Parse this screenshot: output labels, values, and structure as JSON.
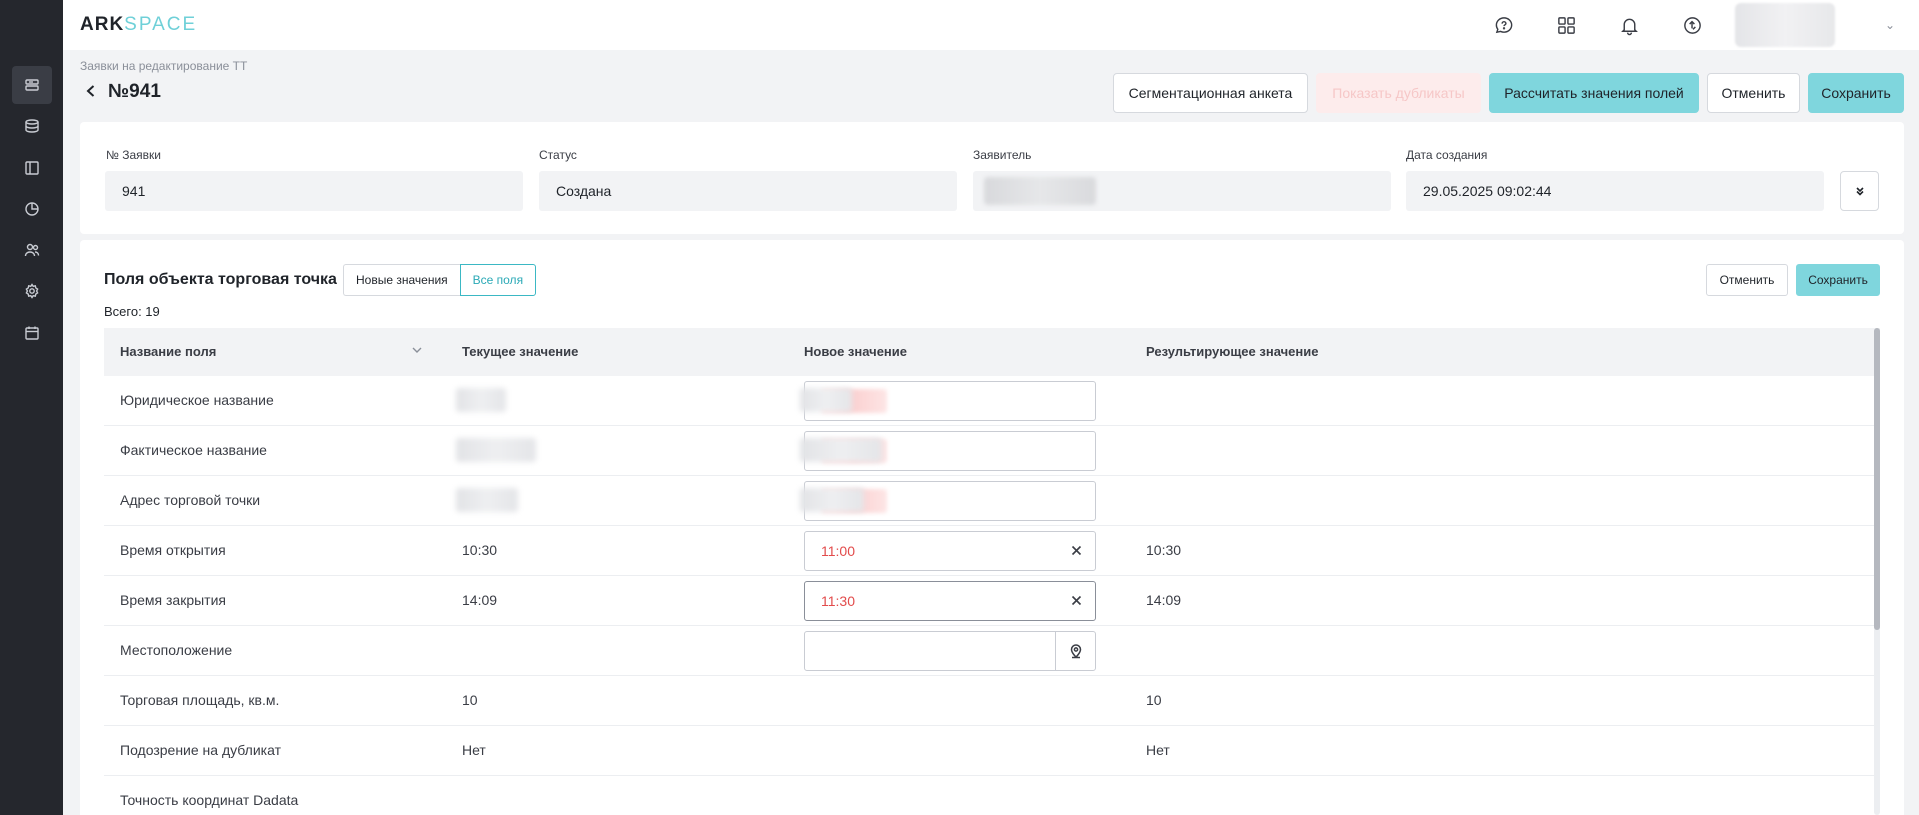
{
  "app": {
    "logo_main": "ARK",
    "logo_accent": "SPACE"
  },
  "sidebar": {
    "items": [
      {
        "icon": "requests-icon",
        "active": true
      },
      {
        "icon": "database-icon",
        "active": false
      },
      {
        "icon": "layout-icon",
        "active": false
      },
      {
        "icon": "chart-icon",
        "active": false
      },
      {
        "icon": "users-icon",
        "active": false
      },
      {
        "icon": "settings-icon",
        "active": false
      },
      {
        "icon": "calendar-icon",
        "active": false
      }
    ]
  },
  "topbar": {
    "icons": [
      "help-chat-icon",
      "apps-grid-icon",
      "bell-icon",
      "sync-icon"
    ]
  },
  "header": {
    "breadcrumb": "Заявки на редактирование ТТ",
    "title": "№941",
    "buttons": {
      "segmentation": "Сегментационная анкета",
      "duplicates": "Показать дубликаты",
      "calculate": "Рассчитать значения полей",
      "cancel": "Отменить",
      "save": "Сохранить"
    }
  },
  "info": {
    "request_no_label": "№ Заявки",
    "request_no_value": "941",
    "status_label": "Статус",
    "status_value": "Создана",
    "applicant_label": "Заявитель",
    "created_label": "Дата создания",
    "created_value": "29.05.2025 09:02:44"
  },
  "fields_section": {
    "title": "Поля объекта торговая точка",
    "toggle_new": "Новые значения",
    "toggle_all": "Все поля",
    "total": "Всего: 19",
    "cancel": "Отменить",
    "save": "Сохранить",
    "columns": {
      "name": "Название поля",
      "current": "Текущее значение",
      "new": "Новое значение",
      "result": "Результирующее значение"
    },
    "rows": [
      {
        "name": "Юридическое название",
        "current": "",
        "new": "",
        "result": ""
      },
      {
        "name": "Фактическое название",
        "current": "",
        "new": "",
        "result": ""
      },
      {
        "name": "Адрес торговой точки",
        "current": "",
        "new": "",
        "result": ""
      },
      {
        "name": "Время открытия",
        "current": "10:30",
        "new": "11:00",
        "result": "10:30"
      },
      {
        "name": "Время закрытия",
        "current": "14:09",
        "new": "11:30",
        "result": "14:09"
      },
      {
        "name": "Местоположение",
        "current": "",
        "new": "",
        "result": ""
      },
      {
        "name": "Торговая площадь, кв.м.",
        "current": "10",
        "new": "",
        "result": "10"
      },
      {
        "name": "Подозрение на дубликат",
        "current": "Нет",
        "new": "",
        "result": "Нет"
      },
      {
        "name": "Точность координат Dadata",
        "current": "",
        "new": "",
        "result": ""
      }
    ]
  }
}
